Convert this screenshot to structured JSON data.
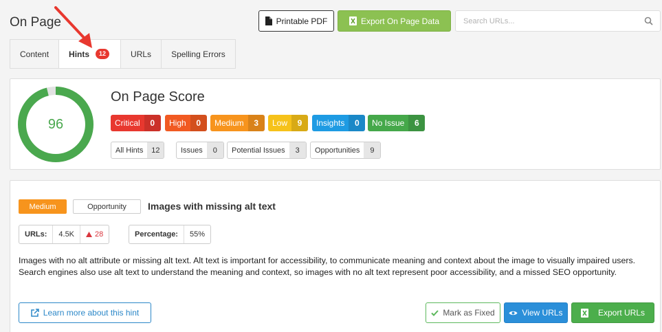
{
  "page": {
    "title": "On Page"
  },
  "toolbar": {
    "printable_pdf": "Printable PDF",
    "export_on_page": "Export On Page Data",
    "search_placeholder": "Search URLs..."
  },
  "tabs": [
    {
      "label": "Content",
      "active": false
    },
    {
      "label": "Hints",
      "active": true,
      "badge": "12"
    },
    {
      "label": "URLs",
      "active": false
    },
    {
      "label": "Spelling Errors",
      "active": false
    }
  ],
  "score": {
    "title": "On Page Score",
    "value": "96",
    "fraction": 0.96,
    "color": "#4aa84e",
    "severity": [
      {
        "label": "Critical",
        "count": "0",
        "color": "#e8382f"
      },
      {
        "label": "High",
        "count": "0",
        "color": "#f15a22"
      },
      {
        "label": "Medium",
        "count": "3",
        "color": "#f7941d"
      },
      {
        "label": "Low",
        "count": "9",
        "color": "#f6c21a"
      },
      {
        "label": "Insights",
        "count": "0",
        "color": "#1e9be3"
      },
      {
        "label": "No Issue",
        "count": "6",
        "color": "#45a84a"
      }
    ],
    "categories": [
      {
        "label": "All Hints",
        "count": "12"
      },
      {
        "label": "Issues",
        "count": "0"
      },
      {
        "label": "Potential Issues",
        "count": "3"
      },
      {
        "label": "Opportunities",
        "count": "9"
      }
    ]
  },
  "hint": {
    "severity": "Medium",
    "type": "Opportunity",
    "title": "Images with missing alt text",
    "urls_label": "URLs:",
    "urls_value": "4.5K",
    "urls_change": "28",
    "percentage_label": "Percentage:",
    "percentage_value": "55%",
    "description": "Images with no alt attribute or missing alt text. Alt text is important for accessibility, to communicate meaning and context about the image to visually impaired users. Search engines also use alt text to understand the meaning and context, so images with no alt text represent poor accessibility, and a missed SEO opportunity.",
    "learn_more": "Learn more about this hint",
    "mark_fixed": "Mark as Fixed",
    "view_urls": "View URLs",
    "export_urls": "Export URLs"
  }
}
